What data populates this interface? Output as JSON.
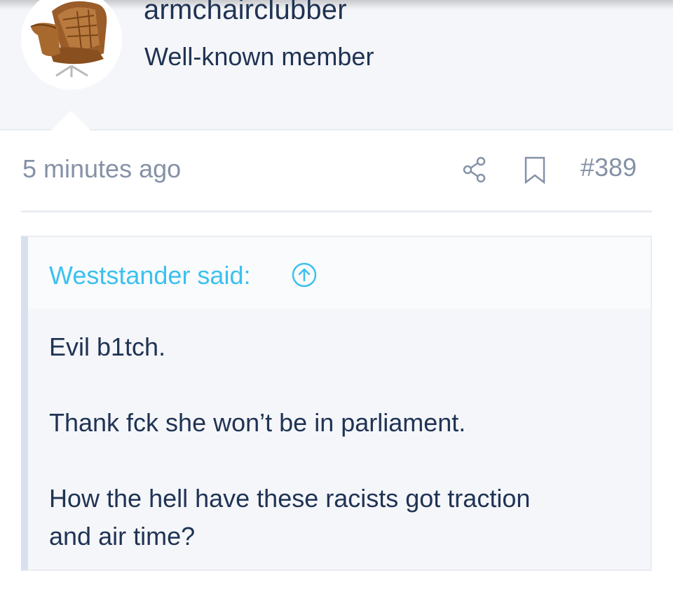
{
  "user": {
    "username": "armchairclubber",
    "title": "Well-known member",
    "avatar_icon": "armchair-avatar"
  },
  "post": {
    "date": "5 minutes ago",
    "share_icon": "share-icon",
    "bookmark_icon": "bookmark-icon",
    "number": "#389"
  },
  "quote": {
    "author_label": "Weststander said:",
    "jump_icon": "arrow-up-circle-icon",
    "lines": [
      "Evil b1tch.",
      "Thank fck she won’t be in parliament.",
      "How the hell have these racists got traction",
      "and air time?"
    ]
  },
  "colors": {
    "text": "#1f3354",
    "muted": "#8591a6",
    "accent": "#3cc0f0",
    "panel": "#f5f6f9"
  }
}
